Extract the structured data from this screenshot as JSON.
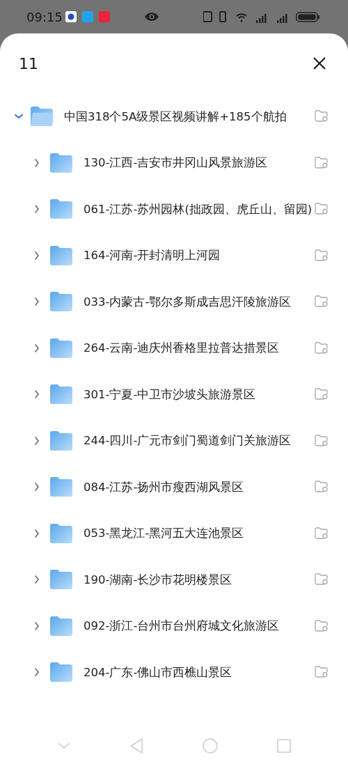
{
  "status_bar": {
    "time": "09:15"
  },
  "sheet": {
    "title": "11"
  },
  "tree": [
    {
      "name": "中国318个5A级景区视频讲解+185个航拍",
      "expanded": true,
      "children": [
        {
          "name": "130-江西-吉安市井冈山风景旅游区",
          "expanded": false
        },
        {
          "name": "061-江苏-苏州园林(拙政园、虎丘山、留园)",
          "expanded": false
        },
        {
          "name": "164-河南-开封清明上河园",
          "expanded": false
        },
        {
          "name": "033-内蒙古-鄂尔多斯成吉思汗陵旅游区",
          "expanded": false
        },
        {
          "name": "264-云南-迪庆州香格里拉普达措景区",
          "expanded": false
        },
        {
          "name": "301-宁夏-中卫市沙坡头旅游景区",
          "expanded": false
        },
        {
          "name": "244-四川-广元市剑门蜀道剑门关旅游区",
          "expanded": false
        },
        {
          "name": "084-江苏-扬州市瘦西湖风景区",
          "expanded": false
        },
        {
          "name": "053-黑龙江-黑河五大连池景区",
          "expanded": false
        },
        {
          "name": "190-湖南-长沙市花明楼景区",
          "expanded": false
        },
        {
          "name": "092-浙江-台州市台州府城文化旅游区",
          "expanded": false
        },
        {
          "name": "204-广东-佛山市西樵山景区",
          "expanded": false
        }
      ]
    }
  ]
}
